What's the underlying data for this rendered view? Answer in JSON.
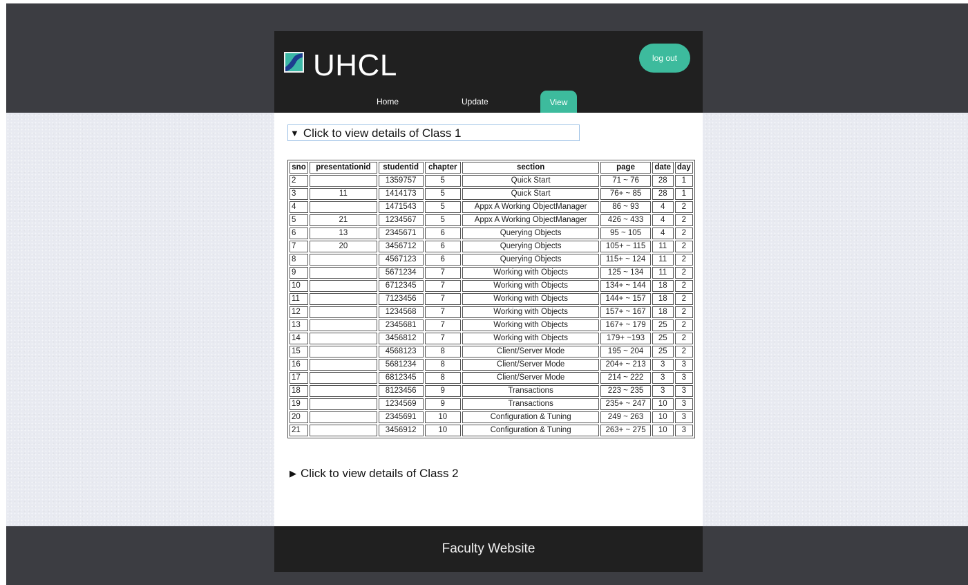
{
  "header": {
    "brand": "UHCL",
    "logout_label": "log out",
    "nav": [
      "Home",
      "Update",
      "View"
    ],
    "active_nav": "View",
    "accent_color": "#3dbb9d"
  },
  "class1": {
    "summary": "Click to view details of Class 1",
    "expanded": true,
    "columns": [
      "sno",
      "presentationid",
      "studentid",
      "chapter",
      "section",
      "page",
      "date",
      "day"
    ],
    "rows": [
      [
        "2",
        "",
        "1359757",
        "5",
        "Quick Start",
        "71 ~ 76",
        "28",
        "1"
      ],
      [
        "3",
        "11",
        "1414173",
        "5",
        "Quick Start",
        "76+ ~ 85",
        "28",
        "1"
      ],
      [
        "4",
        "",
        "1471543",
        "5",
        "Appx A Working ObjectManager",
        "86 ~ 93",
        "4",
        "2"
      ],
      [
        "5",
        "21",
        "1234567",
        "5",
        "Appx A Working ObjectManager",
        "426 ~ 433",
        "4",
        "2"
      ],
      [
        "6",
        "13",
        "2345671",
        "6",
        "Querying Objects",
        "95 ~ 105",
        "4",
        "2"
      ],
      [
        "7",
        "20",
        "3456712",
        "6",
        "Querying Objects",
        "105+ ~ 115",
        "11",
        "2"
      ],
      [
        "8",
        "",
        "4567123",
        "6",
        "Querying Objects",
        "115+ ~ 124",
        "11",
        "2"
      ],
      [
        "9",
        "",
        "5671234",
        "7",
        "Working with Objects",
        "125 ~ 134",
        "11",
        "2"
      ],
      [
        "10",
        "",
        "6712345",
        "7",
        "Working with Objects",
        "134+ ~ 144",
        "18",
        "2"
      ],
      [
        "11",
        "",
        "7123456",
        "7",
        "Working with Objects",
        "144+ ~ 157",
        "18",
        "2"
      ],
      [
        "12",
        "",
        "1234568",
        "7",
        "Working with Objects",
        "157+ ~ 167",
        "18",
        "2"
      ],
      [
        "13",
        "",
        "2345681",
        "7",
        "Working with Objects",
        "167+ ~ 179",
        "25",
        "2"
      ],
      [
        "14",
        "",
        "3456812",
        "7",
        "Working with Objects",
        "179+ ~193",
        "25",
        "2"
      ],
      [
        "15",
        "",
        "4568123",
        "8",
        "Client/Server Mode",
        "195 ~ 204",
        "25",
        "2"
      ],
      [
        "16",
        "",
        "5681234",
        "8",
        "Client/Server Mode",
        "204+ ~ 213",
        "3",
        "3"
      ],
      [
        "17",
        "",
        "6812345",
        "8",
        "Client/Server Mode",
        "214 ~ 222",
        "3",
        "3"
      ],
      [
        "18",
        "",
        "8123456",
        "9",
        "Transactions",
        "223 ~ 235",
        "3",
        "3"
      ],
      [
        "19",
        "",
        "1234569",
        "9",
        "Transactions",
        "235+ ~ 247",
        "10",
        "3"
      ],
      [
        "20",
        "",
        "2345691",
        "10",
        "Configuration & Tuning",
        "249 ~ 263",
        "10",
        "3"
      ],
      [
        "21",
        "",
        "3456912",
        "10",
        "Configuration & Tuning",
        "263+ ~ 275",
        "10",
        "3"
      ]
    ]
  },
  "class2": {
    "summary": "Click to view details of Class 2",
    "expanded": false
  },
  "footer": {
    "text": "Faculty Website"
  }
}
